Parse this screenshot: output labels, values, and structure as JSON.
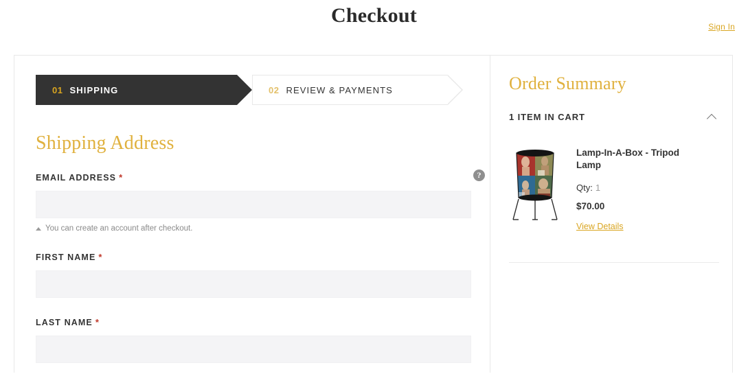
{
  "header": {
    "title": "Checkout",
    "sign_in_label": "Sign In"
  },
  "progress": {
    "steps": [
      {
        "number": "01",
        "label": "SHIPPING",
        "active": true
      },
      {
        "number": "02",
        "label": "REVIEW & PAYMENTS",
        "active": false
      }
    ]
  },
  "shipping": {
    "section_title": "Shipping Address",
    "help_icon_glyph": "?",
    "fields": [
      {
        "label": "EMAIL ADDRESS",
        "required_marker": "*",
        "value": "",
        "placeholder": "",
        "hint": "You can create an account after checkout."
      },
      {
        "label": "FIRST NAME",
        "required_marker": "*",
        "value": "",
        "placeholder": ""
      },
      {
        "label": "LAST NAME",
        "required_marker": "*",
        "value": "",
        "placeholder": ""
      }
    ]
  },
  "order_summary": {
    "title": "Order Summary",
    "cart_count_label": "1 ITEM IN CART",
    "collapse_icon": "chevron-up-icon",
    "product": {
      "name": "Lamp-In-A-Box - Tripod Lamp",
      "qty_label": "Qty:",
      "qty_value": "1",
      "price": "$70.00",
      "view_details_label": "View Details",
      "image_alt": "tripod-lamp-thumbnail"
    }
  },
  "colors": {
    "gold": "#d9a520",
    "heading_gold": "#e0b13e",
    "active_step_bg": "#333333",
    "required_red": "#c0392b",
    "input_bg": "#f4f4f6",
    "border": "#e8e8e8"
  }
}
